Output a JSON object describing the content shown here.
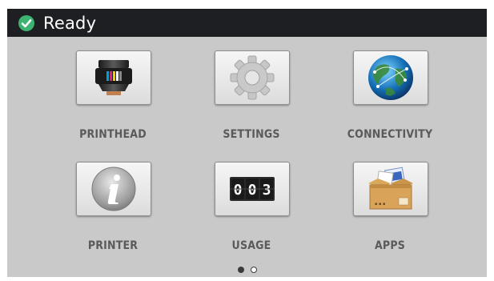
{
  "status_bar": {
    "text": "Ready",
    "icon": "check-circle-icon",
    "icon_color": "#3cb371"
  },
  "tiles": [
    {
      "label": "PRINTHEAD",
      "icon": "printhead-icon"
    },
    {
      "label": "SETTINGS",
      "icon": "gear-icon"
    },
    {
      "label": "CONNECTIVITY",
      "icon": "globe-icon"
    },
    {
      "label": "PRINTER",
      "icon": "info-icon"
    },
    {
      "label": "USAGE",
      "icon": "counter-icon",
      "counter_digits": "003"
    },
    {
      "label": "APPS",
      "icon": "box-icon"
    }
  ],
  "pager": {
    "pages": 2,
    "current": 1
  },
  "colors": {
    "status_bar_bg": "#1d1f22",
    "screen_bg": "#c9c9c9",
    "label_color": "#5a5a5a"
  }
}
